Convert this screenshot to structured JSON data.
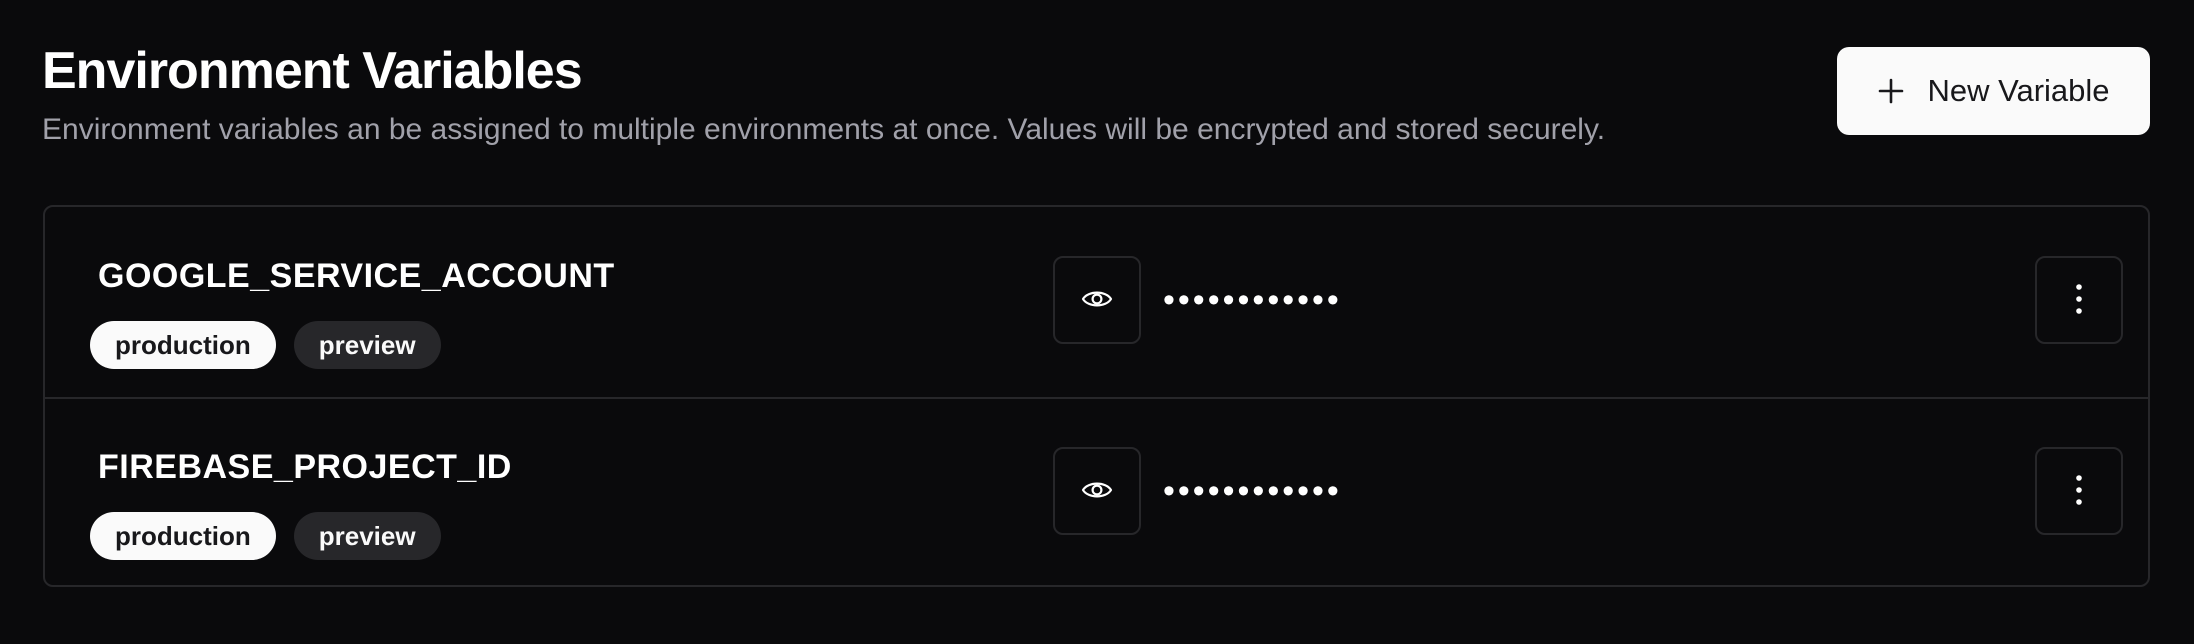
{
  "header": {
    "title": "Environment Variables",
    "subtitle": "Environment variables an be assigned to multiple environments at once. Values will be encrypted and stored securely.",
    "new_button_label": "New Variable",
    "new_button_icon": "plus-icon"
  },
  "variables": [
    {
      "name": "GOOGLE_SERVICE_ACCOUNT",
      "environments": [
        "production",
        "preview"
      ],
      "masked_value": "••••••••••••",
      "reveal_icon": "eye-icon",
      "menu_icon": "more-vertical-icon"
    },
    {
      "name": "FIREBASE_PROJECT_ID",
      "environments": [
        "production",
        "preview"
      ],
      "masked_value": "••••••••••••",
      "reveal_icon": "eye-icon",
      "menu_icon": "more-vertical-icon"
    }
  ],
  "colors": {
    "background": "#0a0a0c",
    "border": "#27272a",
    "muted_text": "#a1a1aa",
    "primary_button_bg": "#fafafa",
    "secondary_badge_bg": "#27272a"
  }
}
